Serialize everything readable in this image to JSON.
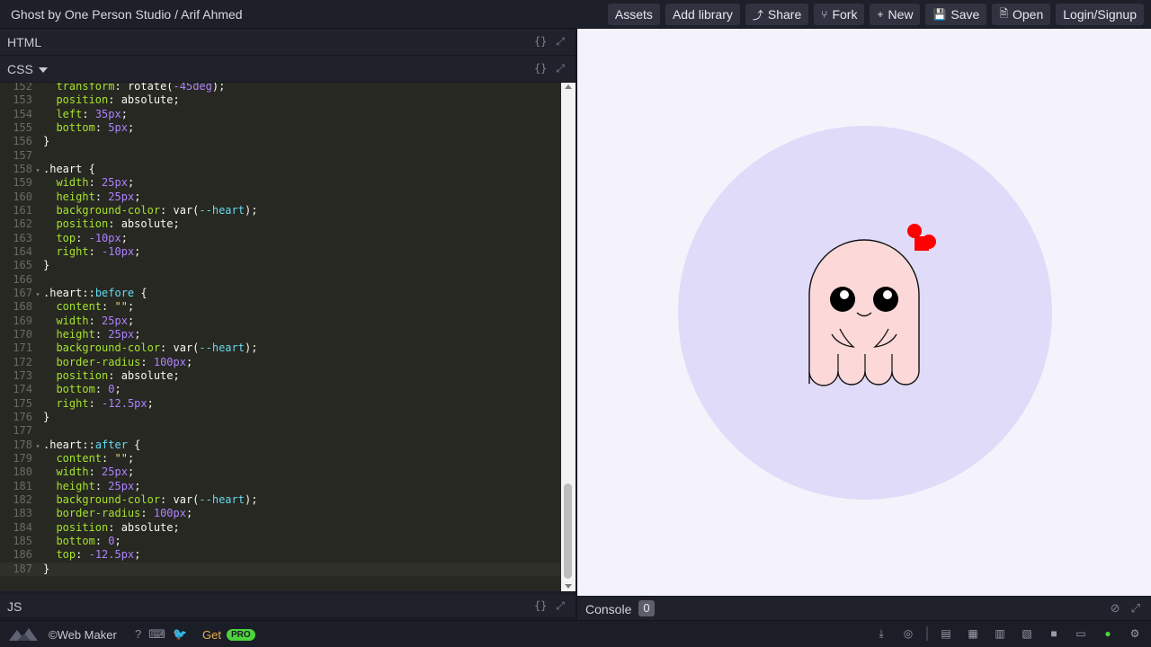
{
  "topbar": {
    "title": "Ghost by One Person Studio / Arif Ahmed",
    "buttons": [
      {
        "label": "Assets",
        "icon": ""
      },
      {
        "label": "Add library",
        "icon": ""
      },
      {
        "label": "Share",
        "icon": "share-icon"
      },
      {
        "label": "Fork",
        "icon": "fork-icon"
      },
      {
        "label": "New",
        "icon": "plus-icon"
      },
      {
        "label": "Save",
        "icon": "floppy-icon"
      },
      {
        "label": "Open",
        "icon": "file-icon"
      },
      {
        "label": "Login/Signup",
        "icon": ""
      }
    ]
  },
  "panes": {
    "html": {
      "label": "HTML"
    },
    "css": {
      "label": "CSS"
    },
    "js": {
      "label": "JS"
    },
    "icon_format": "{}",
    "icon_expand": "⤢"
  },
  "code": {
    "lines": [
      {
        "n": "152",
        "fold": "",
        "text": "  transform: rotate(-45deg);"
      },
      {
        "n": "153",
        "fold": "",
        "text": "  position: absolute;"
      },
      {
        "n": "154",
        "fold": "",
        "text": "  left: 35px;"
      },
      {
        "n": "155",
        "fold": "",
        "text": "  bottom: 5px;"
      },
      {
        "n": "156",
        "fold": "",
        "text": "}"
      },
      {
        "n": "157",
        "fold": "",
        "text": ""
      },
      {
        "n": "158",
        "fold": "▾",
        "text": ".heart {"
      },
      {
        "n": "159",
        "fold": "",
        "text": "  width: 25px;"
      },
      {
        "n": "160",
        "fold": "",
        "text": "  height: 25px;"
      },
      {
        "n": "161",
        "fold": "",
        "text": "  background-color: var(--heart);"
      },
      {
        "n": "162",
        "fold": "",
        "text": "  position: absolute;"
      },
      {
        "n": "163",
        "fold": "",
        "text": "  top: -10px;"
      },
      {
        "n": "164",
        "fold": "",
        "text": "  right: -10px;"
      },
      {
        "n": "165",
        "fold": "",
        "text": "}"
      },
      {
        "n": "166",
        "fold": "",
        "text": ""
      },
      {
        "n": "167",
        "fold": "▾",
        "text": ".heart::before {"
      },
      {
        "n": "168",
        "fold": "",
        "text": "  content: \"\";"
      },
      {
        "n": "169",
        "fold": "",
        "text": "  width: 25px;"
      },
      {
        "n": "170",
        "fold": "",
        "text": "  height: 25px;"
      },
      {
        "n": "171",
        "fold": "",
        "text": "  background-color: var(--heart);"
      },
      {
        "n": "172",
        "fold": "",
        "text": "  border-radius: 100px;"
      },
      {
        "n": "173",
        "fold": "",
        "text": "  position: absolute;"
      },
      {
        "n": "174",
        "fold": "",
        "text": "  bottom: 0;"
      },
      {
        "n": "175",
        "fold": "",
        "text": "  right: -12.5px;"
      },
      {
        "n": "176",
        "fold": "",
        "text": "}"
      },
      {
        "n": "177",
        "fold": "",
        "text": ""
      },
      {
        "n": "178",
        "fold": "▾",
        "text": ".heart::after {"
      },
      {
        "n": "179",
        "fold": "",
        "text": "  content: \"\";"
      },
      {
        "n": "180",
        "fold": "",
        "text": "  width: 25px;"
      },
      {
        "n": "181",
        "fold": "",
        "text": "  height: 25px;"
      },
      {
        "n": "182",
        "fold": "",
        "text": "  background-color: var(--heart);"
      },
      {
        "n": "183",
        "fold": "",
        "text": "  border-radius: 100px;"
      },
      {
        "n": "184",
        "fold": "",
        "text": "  position: absolute;"
      },
      {
        "n": "185",
        "fold": "",
        "text": "  bottom: 0;"
      },
      {
        "n": "186",
        "fold": "",
        "text": "  top: -12.5px;"
      },
      {
        "n": "187",
        "fold": "",
        "text": "}"
      }
    ]
  },
  "preview": {
    "background": "#f4f2fb",
    "circle_color": "#e0dbf8",
    "ghost_color": "#fcd8d8",
    "heart_color": "#ff0000"
  },
  "console": {
    "label": "Console",
    "count": "0"
  },
  "footer": {
    "brand": "©Web Maker",
    "get": "Get",
    "pro": "PRO"
  }
}
